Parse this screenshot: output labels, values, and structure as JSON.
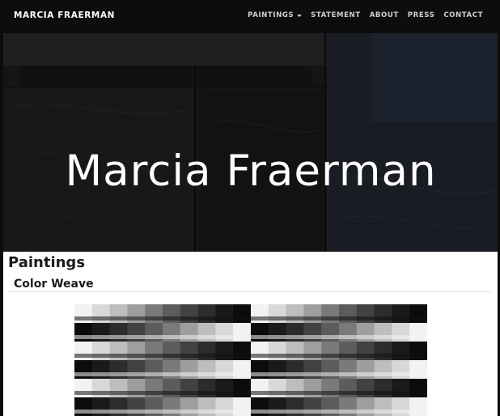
{
  "navbar": {
    "brand": "MARCIA FRAERMAN",
    "items": [
      {
        "label": "PAINTINGS",
        "has_dropdown": true
      },
      {
        "label": "STATEMENT",
        "has_dropdown": false
      },
      {
        "label": "ABOUT",
        "has_dropdown": false
      },
      {
        "label": "PRESS",
        "has_dropdown": false
      },
      {
        "label": "CONTACT",
        "has_dropdown": false
      }
    ]
  },
  "hero": {
    "title": "Marcia Fraerman"
  },
  "main": {
    "section_title": "Paintings",
    "subsection_title": "Color Weave"
  },
  "colors": {
    "navbar_bg": "#0d0d0d",
    "hero_bg": "#161618",
    "text": "#1a1a1a",
    "nav_text": "#cfcfcf"
  },
  "icons": {
    "dropdown": "caret-down-icon"
  }
}
